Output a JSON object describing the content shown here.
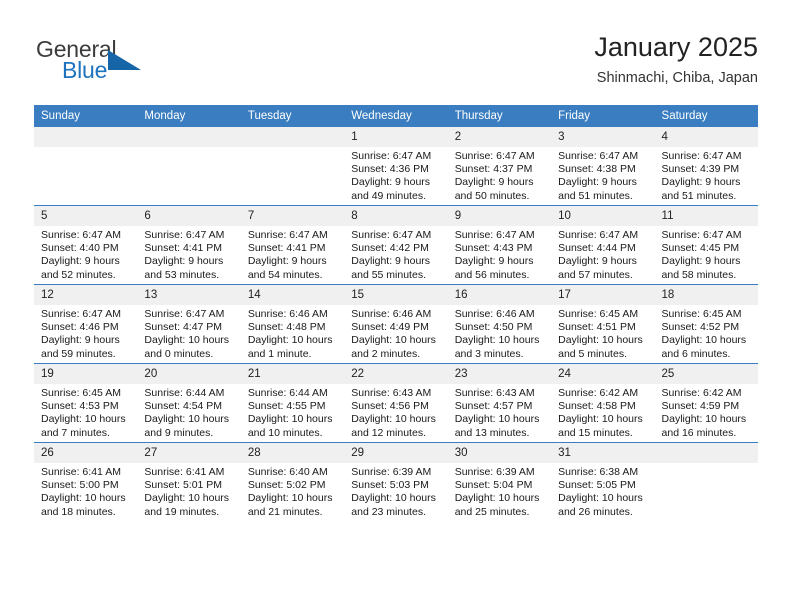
{
  "brand": {
    "name_part1": "General",
    "name_part2": "Blue",
    "logo_icon": "triangle-logo-icon",
    "accent_color": "#1e73be",
    "triangle_color": "#1565a8"
  },
  "header": {
    "title": "January 2025",
    "subtitle": "Shinmachi, Chiba, Japan"
  },
  "calendar": {
    "header_bg": "#3a7dc0",
    "daynum_bg": "#f0f0f0",
    "weekdays": [
      "Sunday",
      "Monday",
      "Tuesday",
      "Wednesday",
      "Thursday",
      "Friday",
      "Saturday"
    ],
    "weeks": [
      [
        {
          "empty": true
        },
        {
          "empty": true
        },
        {
          "empty": true
        },
        {
          "day": "1",
          "sunrise": "Sunrise: 6:47 AM",
          "sunset": "Sunset: 4:36 PM",
          "daylight": "Daylight: 9 hours and 49 minutes."
        },
        {
          "day": "2",
          "sunrise": "Sunrise: 6:47 AM",
          "sunset": "Sunset: 4:37 PM",
          "daylight": "Daylight: 9 hours and 50 minutes."
        },
        {
          "day": "3",
          "sunrise": "Sunrise: 6:47 AM",
          "sunset": "Sunset: 4:38 PM",
          "daylight": "Daylight: 9 hours and 51 minutes."
        },
        {
          "day": "4",
          "sunrise": "Sunrise: 6:47 AM",
          "sunset": "Sunset: 4:39 PM",
          "daylight": "Daylight: 9 hours and 51 minutes."
        }
      ],
      [
        {
          "day": "5",
          "sunrise": "Sunrise: 6:47 AM",
          "sunset": "Sunset: 4:40 PM",
          "daylight": "Daylight: 9 hours and 52 minutes."
        },
        {
          "day": "6",
          "sunrise": "Sunrise: 6:47 AM",
          "sunset": "Sunset: 4:41 PM",
          "daylight": "Daylight: 9 hours and 53 minutes."
        },
        {
          "day": "7",
          "sunrise": "Sunrise: 6:47 AM",
          "sunset": "Sunset: 4:41 PM",
          "daylight": "Daylight: 9 hours and 54 minutes."
        },
        {
          "day": "8",
          "sunrise": "Sunrise: 6:47 AM",
          "sunset": "Sunset: 4:42 PM",
          "daylight": "Daylight: 9 hours and 55 minutes."
        },
        {
          "day": "9",
          "sunrise": "Sunrise: 6:47 AM",
          "sunset": "Sunset: 4:43 PM",
          "daylight": "Daylight: 9 hours and 56 minutes."
        },
        {
          "day": "10",
          "sunrise": "Sunrise: 6:47 AM",
          "sunset": "Sunset: 4:44 PM",
          "daylight": "Daylight: 9 hours and 57 minutes."
        },
        {
          "day": "11",
          "sunrise": "Sunrise: 6:47 AM",
          "sunset": "Sunset: 4:45 PM",
          "daylight": "Daylight: 9 hours and 58 minutes."
        }
      ],
      [
        {
          "day": "12",
          "sunrise": "Sunrise: 6:47 AM",
          "sunset": "Sunset: 4:46 PM",
          "daylight": "Daylight: 9 hours and 59 minutes."
        },
        {
          "day": "13",
          "sunrise": "Sunrise: 6:47 AM",
          "sunset": "Sunset: 4:47 PM",
          "daylight": "Daylight: 10 hours and 0 minutes."
        },
        {
          "day": "14",
          "sunrise": "Sunrise: 6:46 AM",
          "sunset": "Sunset: 4:48 PM",
          "daylight": "Daylight: 10 hours and 1 minute."
        },
        {
          "day": "15",
          "sunrise": "Sunrise: 6:46 AM",
          "sunset": "Sunset: 4:49 PM",
          "daylight": "Daylight: 10 hours and 2 minutes."
        },
        {
          "day": "16",
          "sunrise": "Sunrise: 6:46 AM",
          "sunset": "Sunset: 4:50 PM",
          "daylight": "Daylight: 10 hours and 3 minutes."
        },
        {
          "day": "17",
          "sunrise": "Sunrise: 6:45 AM",
          "sunset": "Sunset: 4:51 PM",
          "daylight": "Daylight: 10 hours and 5 minutes."
        },
        {
          "day": "18",
          "sunrise": "Sunrise: 6:45 AM",
          "sunset": "Sunset: 4:52 PM",
          "daylight": "Daylight: 10 hours and 6 minutes."
        }
      ],
      [
        {
          "day": "19",
          "sunrise": "Sunrise: 6:45 AM",
          "sunset": "Sunset: 4:53 PM",
          "daylight": "Daylight: 10 hours and 7 minutes."
        },
        {
          "day": "20",
          "sunrise": "Sunrise: 6:44 AM",
          "sunset": "Sunset: 4:54 PM",
          "daylight": "Daylight: 10 hours and 9 minutes."
        },
        {
          "day": "21",
          "sunrise": "Sunrise: 6:44 AM",
          "sunset": "Sunset: 4:55 PM",
          "daylight": "Daylight: 10 hours and 10 minutes."
        },
        {
          "day": "22",
          "sunrise": "Sunrise: 6:43 AM",
          "sunset": "Sunset: 4:56 PM",
          "daylight": "Daylight: 10 hours and 12 minutes."
        },
        {
          "day": "23",
          "sunrise": "Sunrise: 6:43 AM",
          "sunset": "Sunset: 4:57 PM",
          "daylight": "Daylight: 10 hours and 13 minutes."
        },
        {
          "day": "24",
          "sunrise": "Sunrise: 6:42 AM",
          "sunset": "Sunset: 4:58 PM",
          "daylight": "Daylight: 10 hours and 15 minutes."
        },
        {
          "day": "25",
          "sunrise": "Sunrise: 6:42 AM",
          "sunset": "Sunset: 4:59 PM",
          "daylight": "Daylight: 10 hours and 16 minutes."
        }
      ],
      [
        {
          "day": "26",
          "sunrise": "Sunrise: 6:41 AM",
          "sunset": "Sunset: 5:00 PM",
          "daylight": "Daylight: 10 hours and 18 minutes."
        },
        {
          "day": "27",
          "sunrise": "Sunrise: 6:41 AM",
          "sunset": "Sunset: 5:01 PM",
          "daylight": "Daylight: 10 hours and 19 minutes."
        },
        {
          "day": "28",
          "sunrise": "Sunrise: 6:40 AM",
          "sunset": "Sunset: 5:02 PM",
          "daylight": "Daylight: 10 hours and 21 minutes."
        },
        {
          "day": "29",
          "sunrise": "Sunrise: 6:39 AM",
          "sunset": "Sunset: 5:03 PM",
          "daylight": "Daylight: 10 hours and 23 minutes."
        },
        {
          "day": "30",
          "sunrise": "Sunrise: 6:39 AM",
          "sunset": "Sunset: 5:04 PM",
          "daylight": "Daylight: 10 hours and 25 minutes."
        },
        {
          "day": "31",
          "sunrise": "Sunrise: 6:38 AM",
          "sunset": "Sunset: 5:05 PM",
          "daylight": "Daylight: 10 hours and 26 minutes."
        },
        {
          "empty": true
        }
      ]
    ]
  }
}
